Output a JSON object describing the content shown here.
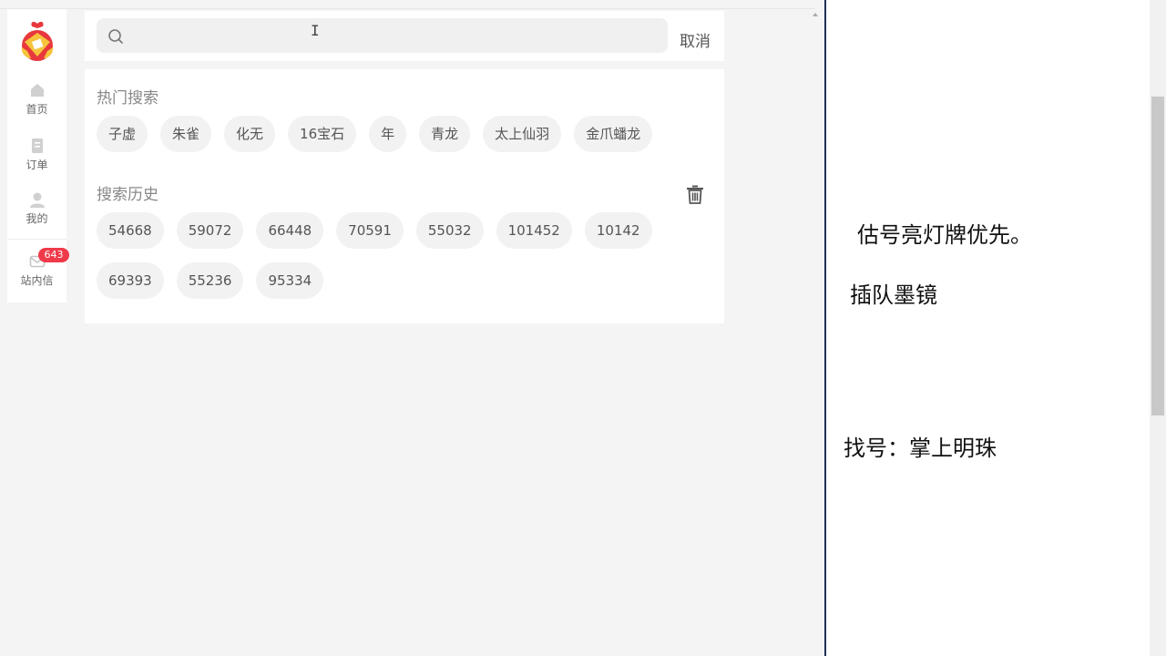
{
  "colors": {
    "badge": "#f03a4a",
    "logo_red": "#e8383d",
    "logo_gold": "#f6c43c",
    "window_divider": "#1c2f55"
  },
  "sidebar": {
    "logo_icon": "bell-gift-logo",
    "items": [
      {
        "label": "首页",
        "icon": "home-icon"
      },
      {
        "label": "订单",
        "icon": "order-icon"
      },
      {
        "label": "我的",
        "icon": "user-icon"
      }
    ],
    "messages": {
      "label": "站内信",
      "icon": "mail-icon",
      "badge": "643"
    }
  },
  "search": {
    "value": "",
    "placeholder": "",
    "cancel_label": "取消"
  },
  "hot_search": {
    "title": "热门搜索",
    "tags": [
      "子虚",
      "朱雀",
      "化无",
      "16宝石",
      "年",
      "青龙",
      "太上仙羽",
      "金爪蟠龙"
    ]
  },
  "history": {
    "title": "搜索历史",
    "rows": [
      [
        "54668",
        "59072",
        "66448",
        "70591",
        "55032",
        "101452",
        "10142"
      ],
      [
        "69393",
        "55236",
        "95334"
      ]
    ],
    "delete_icon": "trash-icon"
  },
  "notes": [
    "估号亮灯牌优先。",
    "插队墨镜",
    "找号：掌上明珠"
  ]
}
